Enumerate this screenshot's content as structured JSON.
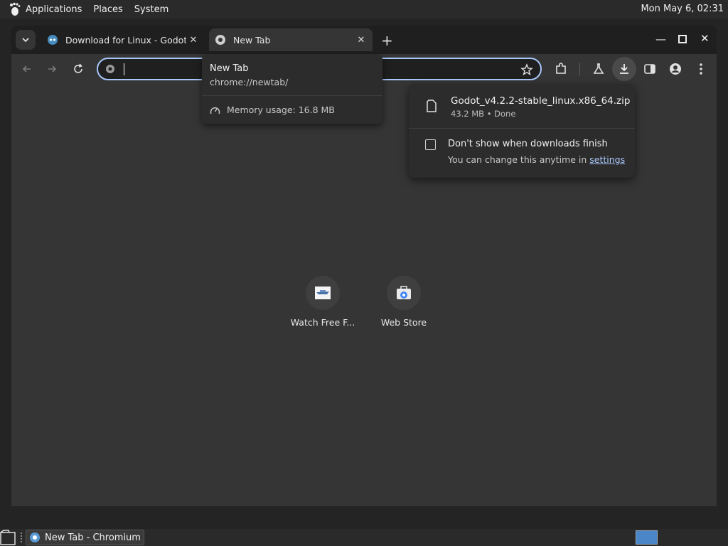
{
  "top_panel": {
    "menu": [
      "Applications",
      "Places",
      "System"
    ],
    "clock": "Mon May  6, 02:31"
  },
  "tabs": [
    {
      "title": "Download for Linux - Godot E",
      "active": false
    },
    {
      "title": "New Tab",
      "active": true
    }
  ],
  "hover_card": {
    "title": "New Tab",
    "url": "chrome://newtab/",
    "memory": "Memory usage: 16.8 MB"
  },
  "omnibox": {
    "value": ""
  },
  "shortcuts": [
    {
      "label": "Watch Free F..."
    },
    {
      "label": "Web Store"
    }
  ],
  "download_bubble": {
    "file_name": "Godot_v4.2.2-stable_linux.x86_64.zip",
    "status": "43.2 MB • Done",
    "checkbox_label": "Don't show when downloads finish",
    "hint_prefix": "You can change this anytime in ",
    "hint_link": "settings"
  },
  "taskbar": {
    "item": "New Tab - Chromium"
  },
  "colors": {
    "accent": "#a8c7fa",
    "toolbar": "#353535",
    "tabstrip": "#1f1f1f"
  }
}
